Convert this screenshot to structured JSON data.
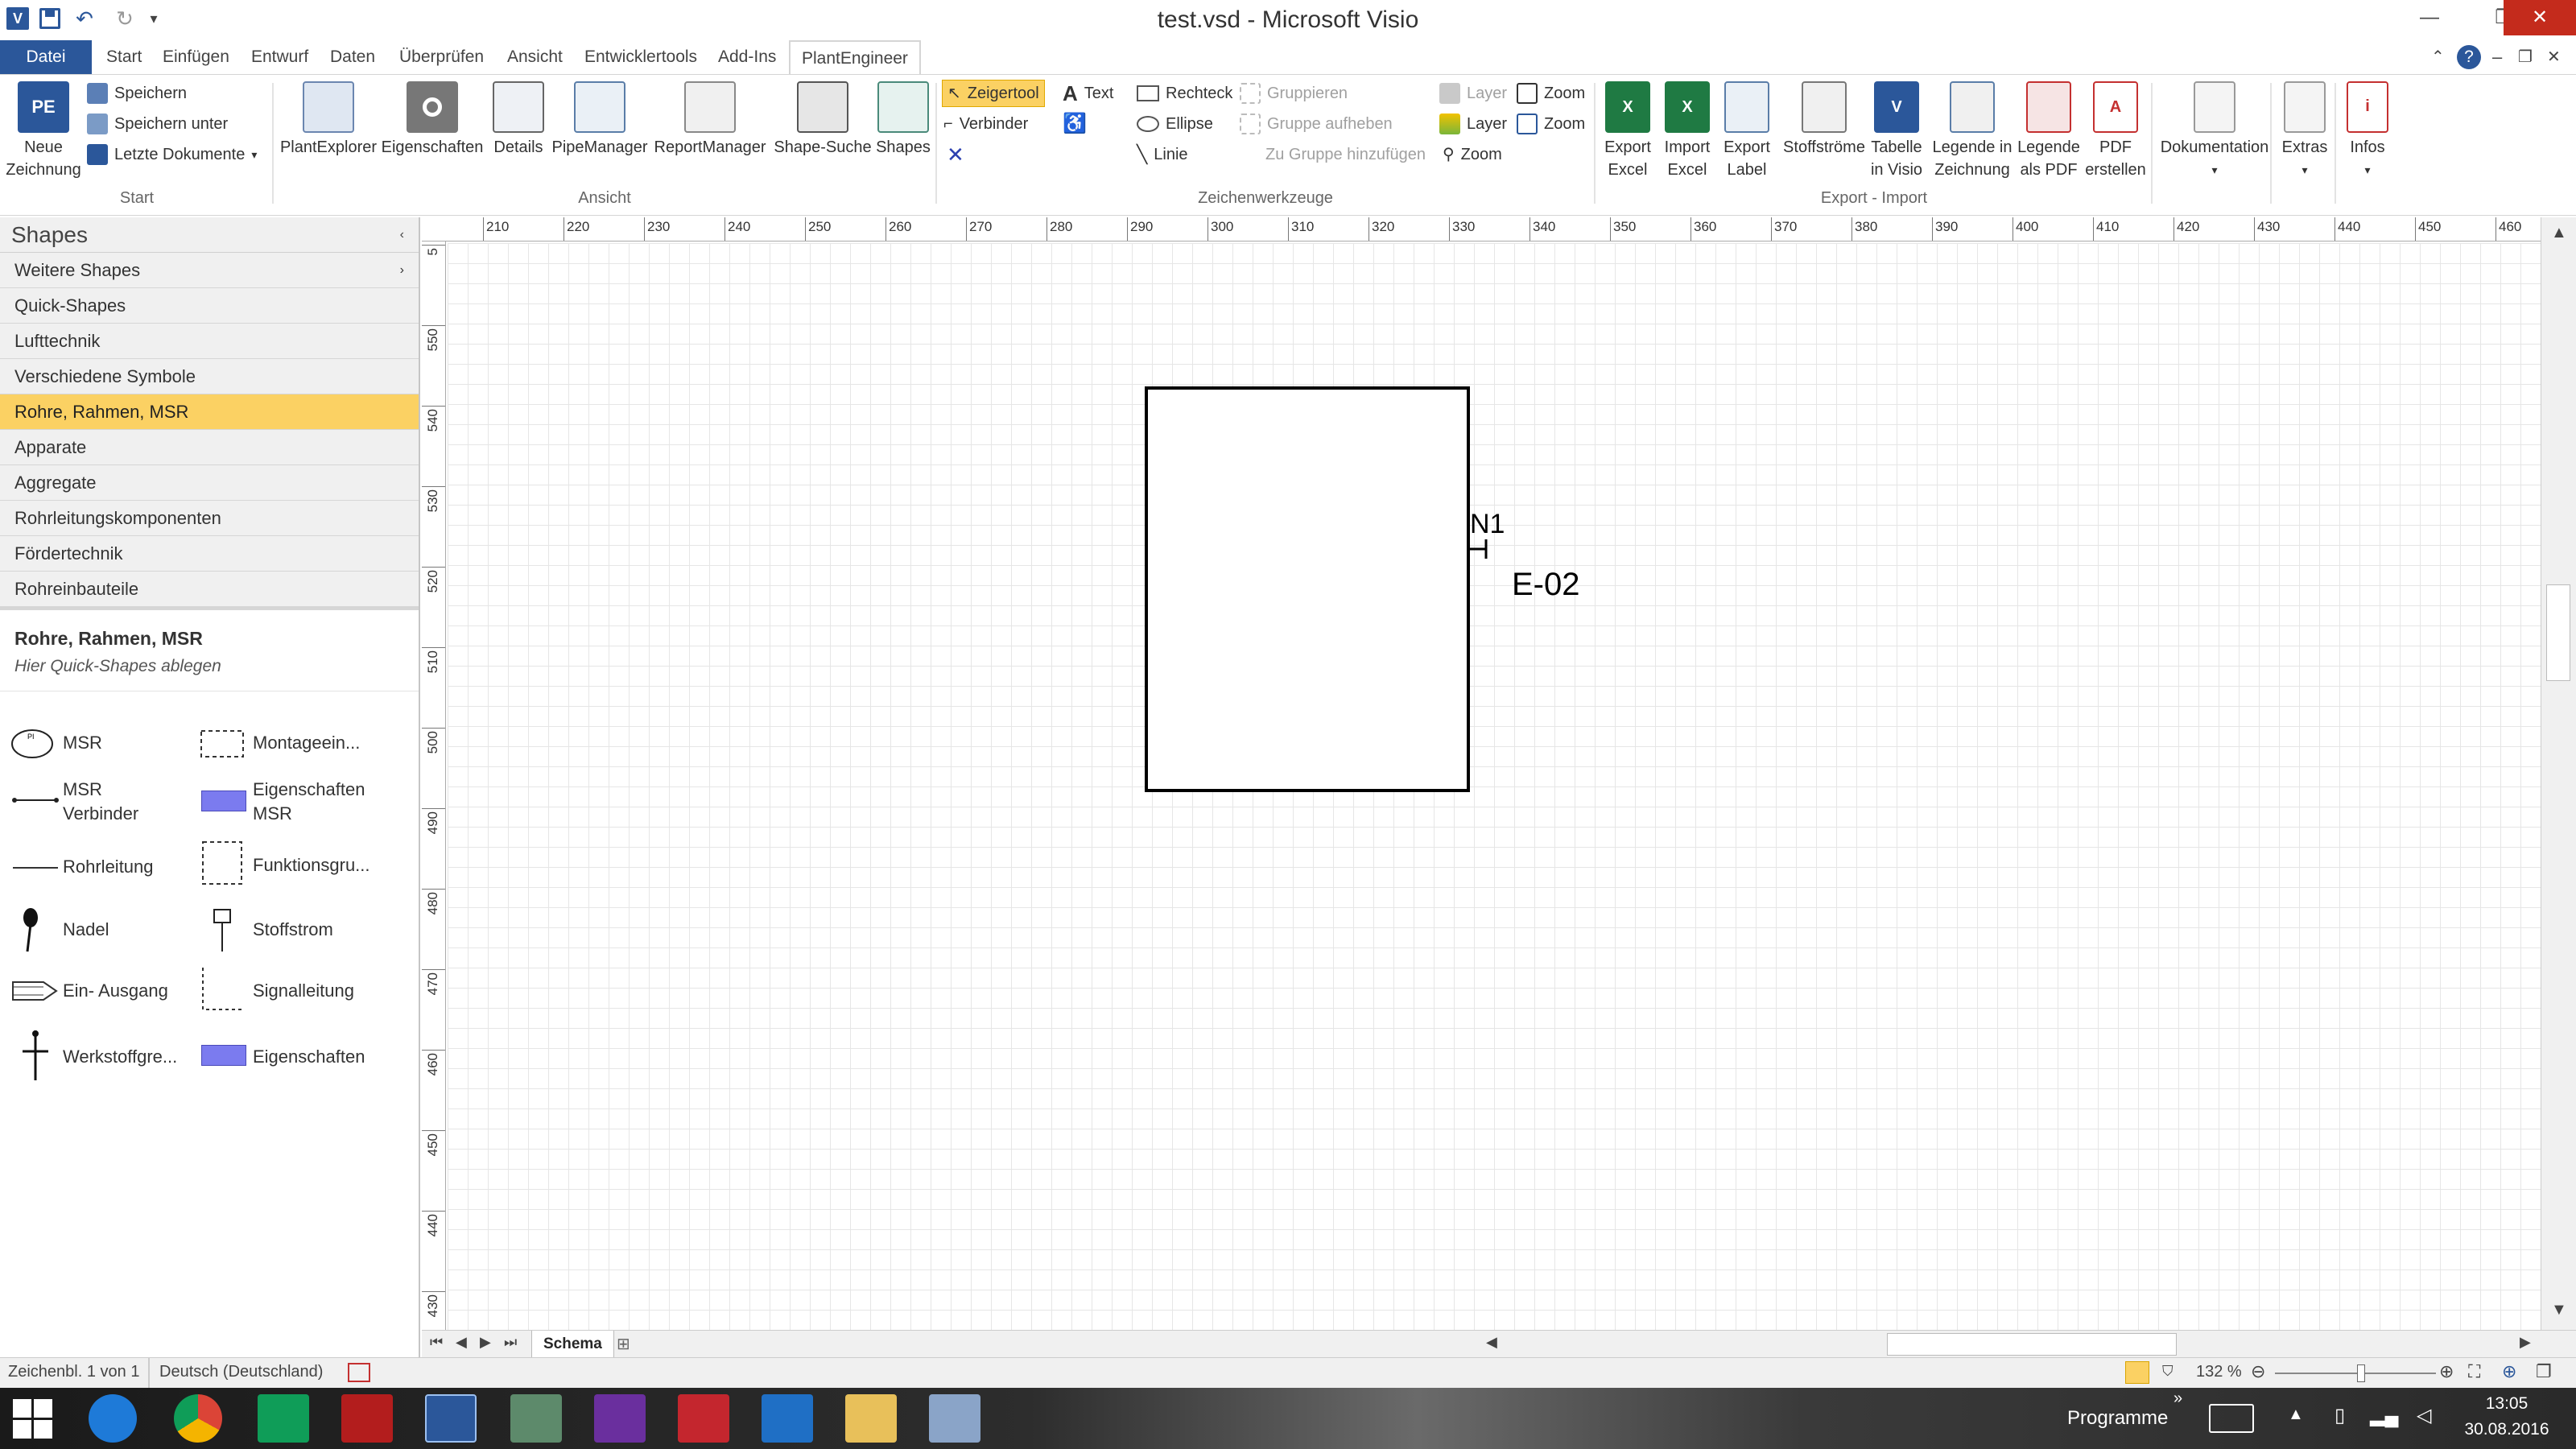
{
  "window": {
    "title": "test.vsd - Microsoft Visio"
  },
  "qat": {
    "app_icon": "visio-logo-icon",
    "save": "save-icon",
    "undo": "undo-icon",
    "redo": "redo-icon"
  },
  "tabs": [
    "Datei",
    "Start",
    "Einfügen",
    "Entwurf",
    "Daten",
    "Überprüfen",
    "Ansicht",
    "Entwicklertools",
    "Add-Ins",
    "PlantEngineer"
  ],
  "ribbon": {
    "start": {
      "neue_zeichnung": "Neue\nZeichnung",
      "speichern": "Speichern",
      "speichern_unter": "Speichern unter",
      "letzte": "Letzte Dokumente",
      "group": "Start"
    },
    "ansicht": {
      "buttons": [
        "PlantExplorer",
        "Eigenschaften",
        "Details",
        "PipeManager",
        "ReportManager",
        "Shape-Suche",
        "Shapes"
      ],
      "group": "Ansicht"
    },
    "zeichen": {
      "zeigertool": "Zeigertool",
      "verbinder": "Verbinder",
      "text": "Text",
      "rechteck": "Rechteck",
      "ellipse": "Ellipse",
      "linie": "Linie",
      "gruppieren": "Gruppieren",
      "gruppe_aufheben": "Gruppe aufheben",
      "zu_gruppe": "Zu Gruppe hinzufügen",
      "layer1": "Layer",
      "layer2": "Layer",
      "zoom1": "Zoom",
      "zoom2": "Zoom",
      "zoom3": "Zoom",
      "group": "Zeichenwerkzeuge"
    },
    "export": {
      "buttons": [
        [
          "Export",
          "Excel"
        ],
        [
          "Import",
          "Excel"
        ],
        [
          "Export",
          "Label"
        ],
        [
          "Stoffströme",
          ""
        ],
        [
          "Tabelle",
          "in Visio"
        ],
        [
          "Legende in",
          "Zeichnung"
        ],
        [
          "Legende",
          "als PDF"
        ],
        [
          "PDF",
          "erstellen"
        ]
      ],
      "group": "Export - Import"
    },
    "extra": {
      "dokumentation": "Dokumentation",
      "extras": "Extras",
      "infos": "Infos"
    }
  },
  "shapes_pane": {
    "title": "Shapes",
    "stencils": [
      "Weitere Shapes",
      "Quick-Shapes",
      "Lufttechnik",
      "Verschiedene Symbole",
      "Rohre, Rahmen, MSR",
      "Apparate",
      "Aggregate",
      "Rohrleitungskomponenten",
      "Fördertechnik",
      "Rohreinbauteile"
    ],
    "active_index": 4,
    "current_title": "Rohre, Rahmen, MSR",
    "current_hint": "Hier Quick-Shapes ablegen",
    "masters": [
      [
        "MSR",
        "Montageein..."
      ],
      [
        "MSR\nVerbinder",
        "Eigenschaften\nMSR"
      ],
      [
        "Rohrleitung",
        "Funktionsgru..."
      ],
      [
        "Nadel",
        "Stoffstrom"
      ],
      [
        "Ein- Ausgang",
        "Signalleitung"
      ],
      [
        "Werkstoffgre...",
        "Eigenschaften"
      ]
    ]
  },
  "rulers": {
    "h": [
      "210",
      "220",
      "230",
      "240",
      "250",
      "260",
      "270",
      "280",
      "290",
      "300",
      "310",
      "320",
      "330",
      "340",
      "350",
      "360",
      "370",
      "380",
      "390",
      "400",
      "410",
      "420",
      "430",
      "440",
      "450",
      "460"
    ],
    "v": [
      "5",
      "550",
      "540",
      "530",
      "520",
      "510",
      "500",
      "490",
      "480",
      "470",
      "460",
      "450",
      "440",
      "430"
    ]
  },
  "drawing": {
    "nozzle_label": "N1",
    "equipment_label": "E-02"
  },
  "pagebar": {
    "page_tab": "Schema"
  },
  "status": {
    "page": "Zeichenbl. 1 von 1",
    "language": "Deutsch (Deutschland)",
    "zoom": "132 %"
  },
  "taskbar": {
    "programme": "Programme",
    "time": "13:05",
    "date": "30.08.2016"
  },
  "colors": {
    "accent": "#2b579a",
    "active_stencil": "#fbd163",
    "master_fill": "#7b7bef"
  }
}
